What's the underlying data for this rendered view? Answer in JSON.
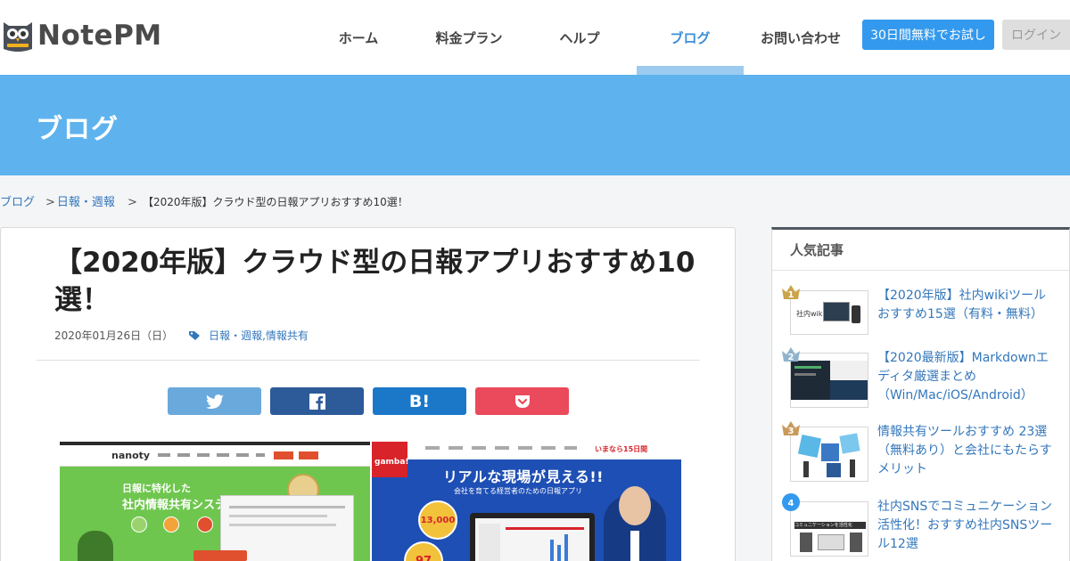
{
  "brand": {
    "name": "NotePM"
  },
  "nav": {
    "items": [
      {
        "label": "ホーム"
      },
      {
        "label": "料金プラン"
      },
      {
        "label": "ヘルプ"
      },
      {
        "label": "ブログ"
      },
      {
        "label": "お問い合わせ"
      }
    ],
    "active": "ブログ",
    "trial_button": "30日間無料でお試し",
    "login_button": "ログイン"
  },
  "banner": {
    "title": "ブログ"
  },
  "breadcrumb": {
    "items": [
      "ブログ",
      "日報・週報"
    ],
    "separator": ">",
    "current": "【2020年版】クラウド型の日報アプリおすすめ10選！"
  },
  "article": {
    "title": "【2020年版】クラウド型の日報アプリおすすめ10選！",
    "date": "2020年01月26日（日）",
    "categories": "日報・週報,情報共有",
    "share": {
      "hatena_label": "B!"
    },
    "hero": {
      "left": {
        "logo": "nanoty",
        "headline_1": "日報に特化した",
        "headline_2": "社内情報共有システム"
      },
      "right": {
        "logo": "gamba!",
        "badge": "いまなら15日間",
        "headline": "リアルな現場が見える!!",
        "sub": "会社を育てる経営者のための日報アプリ",
        "stat_1": "13,000",
        "stat_2": "97"
      }
    }
  },
  "sidebar": {
    "heading": "人気記事",
    "ranking": [
      {
        "rank": "1",
        "title": "【2020年版】社内wikiツールおすすめ15選（有料・無料）",
        "thumb_text": "社内wiki",
        "badge_color": "#c9a44a"
      },
      {
        "rank": "2",
        "title": "【2020最新版】Markdownエディタ厳選まとめ（Win/Mac/iOS/Android）",
        "thumb_text": "",
        "badge_color": "#8fb3cc"
      },
      {
        "rank": "3",
        "title": "情報共有ツールおすすめ 23選（無料あり）と会社にもたらすメリット",
        "thumb_text": "",
        "badge_color": "#c99a5a"
      },
      {
        "rank": "4",
        "title": "社内SNSでコミュニケーション活性化！おすすめ社内SNSツール12選",
        "thumb_text": "コミュニケーションを活性化",
        "badge_color": "#3399ee"
      }
    ]
  }
}
